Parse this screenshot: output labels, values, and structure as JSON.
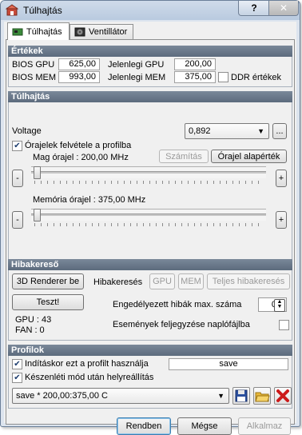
{
  "window": {
    "title": "Túlhajtás",
    "help_label": "?",
    "close_label": "✕"
  },
  "tabs": [
    {
      "label": "Túlhajtás",
      "icon": "card-icon",
      "active": true
    },
    {
      "label": "Ventillátor",
      "icon": "fan-icon",
      "active": false
    }
  ],
  "ertekek": {
    "header": "Értékek",
    "bios_gpu_label": "BIOS GPU",
    "bios_gpu_value": "625,00",
    "bios_mem_label": "BIOS MEM",
    "bios_mem_value": "993,00",
    "cur_gpu_label": "Jelenlegi GPU",
    "cur_gpu_value": "200,00",
    "cur_mem_label": "Jelenlegi MEM",
    "cur_mem_value": "375,00",
    "ddr_label": "DDR értékek",
    "ddr_checked": false
  },
  "tulhajtas": {
    "header": "Túlhajtás",
    "voltage_label": "Voltage",
    "voltage_value": "0,892",
    "ellipsis_label": "...",
    "record_label": "Órajelek felvétele a profilba",
    "record_checked": true,
    "calc_label": "Számítás",
    "default_clock_label": "Órajel alapérték",
    "core_clock_label": "Mag órajel : 200,00 MHz",
    "core_slider_fraction": 0.0,
    "mem_clock_label": "Memória órajel : 375,00 MHz",
    "mem_slider_fraction": 0.0,
    "minus_label": "-",
    "plus_label": "+"
  },
  "hibakereses": {
    "header": "Hibakereső",
    "renderer_label": "3D Renderer be",
    "debug_label": "Hibakeresés",
    "gpu_label": "GPU",
    "mem_label": "MEM",
    "full_debug_label": "Teljes hibakeresés",
    "test_label": "Teszt!",
    "max_errors_label": "Engedélyezett hibák max. száma",
    "max_errors_value": "0",
    "log_label": "Események feljegyzése naplófájlba",
    "log_checked": false,
    "gpu_stat": "GPU : 43",
    "fan_stat": "FAN : 0"
  },
  "profilok": {
    "header": "Profilok",
    "startup_label": "Indításkor ezt a profilt használja",
    "startup_checked": true,
    "startup_profile": "save",
    "restore_label": "Készenléti mód után helyreállítás",
    "restore_checked": true,
    "profile_value": "save * 200,00:375,00 C"
  },
  "footer": {
    "ok_label": "Rendben",
    "cancel_label": "Mégse",
    "apply_label": "Alkalmaz"
  },
  "colors": {
    "section_header": "#6b7a8c",
    "delete_red": "#cc1a1a",
    "save_blue": "#2a4f9e",
    "folder_yellow": "#e8b83a"
  }
}
